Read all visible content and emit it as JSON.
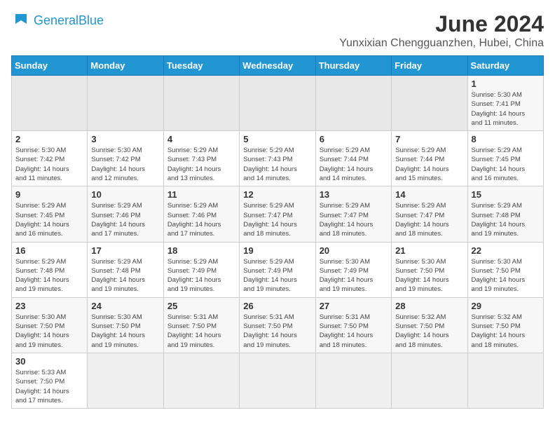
{
  "logo": {
    "text_general": "General",
    "text_blue": "Blue"
  },
  "title": "June 2024",
  "subtitle": "Yunxixian Chengguanzhen, Hubei, China",
  "weekdays": [
    "Sunday",
    "Monday",
    "Tuesday",
    "Wednesday",
    "Thursday",
    "Friday",
    "Saturday"
  ],
  "weeks": [
    [
      {
        "day": "",
        "info": ""
      },
      {
        "day": "",
        "info": ""
      },
      {
        "day": "",
        "info": ""
      },
      {
        "day": "",
        "info": ""
      },
      {
        "day": "",
        "info": ""
      },
      {
        "day": "",
        "info": ""
      },
      {
        "day": "1",
        "info": "Sunrise: 5:30 AM\nSunset: 7:41 PM\nDaylight: 14 hours\nand 11 minutes."
      }
    ],
    [
      {
        "day": "2",
        "info": "Sunrise: 5:30 AM\nSunset: 7:42 PM\nDaylight: 14 hours\nand 11 minutes."
      },
      {
        "day": "3",
        "info": "Sunrise: 5:30 AM\nSunset: 7:42 PM\nDaylight: 14 hours\nand 12 minutes."
      },
      {
        "day": "4",
        "info": "Sunrise: 5:29 AM\nSunset: 7:43 PM\nDaylight: 14 hours\nand 13 minutes."
      },
      {
        "day": "5",
        "info": "Sunrise: 5:29 AM\nSunset: 7:43 PM\nDaylight: 14 hours\nand 14 minutes."
      },
      {
        "day": "6",
        "info": "Sunrise: 5:29 AM\nSunset: 7:44 PM\nDaylight: 14 hours\nand 14 minutes."
      },
      {
        "day": "7",
        "info": "Sunrise: 5:29 AM\nSunset: 7:44 PM\nDaylight: 14 hours\nand 15 minutes."
      },
      {
        "day": "8",
        "info": "Sunrise: 5:29 AM\nSunset: 7:45 PM\nDaylight: 14 hours\nand 16 minutes."
      }
    ],
    [
      {
        "day": "9",
        "info": "Sunrise: 5:29 AM\nSunset: 7:45 PM\nDaylight: 14 hours\nand 16 minutes."
      },
      {
        "day": "10",
        "info": "Sunrise: 5:29 AM\nSunset: 7:46 PM\nDaylight: 14 hours\nand 17 minutes."
      },
      {
        "day": "11",
        "info": "Sunrise: 5:29 AM\nSunset: 7:46 PM\nDaylight: 14 hours\nand 17 minutes."
      },
      {
        "day": "12",
        "info": "Sunrise: 5:29 AM\nSunset: 7:47 PM\nDaylight: 14 hours\nand 18 minutes."
      },
      {
        "day": "13",
        "info": "Sunrise: 5:29 AM\nSunset: 7:47 PM\nDaylight: 14 hours\nand 18 minutes."
      },
      {
        "day": "14",
        "info": "Sunrise: 5:29 AM\nSunset: 7:47 PM\nDaylight: 14 hours\nand 18 minutes."
      },
      {
        "day": "15",
        "info": "Sunrise: 5:29 AM\nSunset: 7:48 PM\nDaylight: 14 hours\nand 19 minutes."
      }
    ],
    [
      {
        "day": "16",
        "info": "Sunrise: 5:29 AM\nSunset: 7:48 PM\nDaylight: 14 hours\nand 19 minutes."
      },
      {
        "day": "17",
        "info": "Sunrise: 5:29 AM\nSunset: 7:48 PM\nDaylight: 14 hours\nand 19 minutes."
      },
      {
        "day": "18",
        "info": "Sunrise: 5:29 AM\nSunset: 7:49 PM\nDaylight: 14 hours\nand 19 minutes."
      },
      {
        "day": "19",
        "info": "Sunrise: 5:29 AM\nSunset: 7:49 PM\nDaylight: 14 hours\nand 19 minutes."
      },
      {
        "day": "20",
        "info": "Sunrise: 5:30 AM\nSunset: 7:49 PM\nDaylight: 14 hours\nand 19 minutes."
      },
      {
        "day": "21",
        "info": "Sunrise: 5:30 AM\nSunset: 7:50 PM\nDaylight: 14 hours\nand 19 minutes."
      },
      {
        "day": "22",
        "info": "Sunrise: 5:30 AM\nSunset: 7:50 PM\nDaylight: 14 hours\nand 19 minutes."
      }
    ],
    [
      {
        "day": "23",
        "info": "Sunrise: 5:30 AM\nSunset: 7:50 PM\nDaylight: 14 hours\nand 19 minutes."
      },
      {
        "day": "24",
        "info": "Sunrise: 5:30 AM\nSunset: 7:50 PM\nDaylight: 14 hours\nand 19 minutes."
      },
      {
        "day": "25",
        "info": "Sunrise: 5:31 AM\nSunset: 7:50 PM\nDaylight: 14 hours\nand 19 minutes."
      },
      {
        "day": "26",
        "info": "Sunrise: 5:31 AM\nSunset: 7:50 PM\nDaylight: 14 hours\nand 19 minutes."
      },
      {
        "day": "27",
        "info": "Sunrise: 5:31 AM\nSunset: 7:50 PM\nDaylight: 14 hours\nand 18 minutes."
      },
      {
        "day": "28",
        "info": "Sunrise: 5:32 AM\nSunset: 7:50 PM\nDaylight: 14 hours\nand 18 minutes."
      },
      {
        "day": "29",
        "info": "Sunrise: 5:32 AM\nSunset: 7:50 PM\nDaylight: 14 hours\nand 18 minutes."
      }
    ],
    [
      {
        "day": "30",
        "info": "Sunrise: 5:33 AM\nSunset: 7:50 PM\nDaylight: 14 hours\nand 17 minutes."
      },
      {
        "day": "",
        "info": ""
      },
      {
        "day": "",
        "info": ""
      },
      {
        "day": "",
        "info": ""
      },
      {
        "day": "",
        "info": ""
      },
      {
        "day": "",
        "info": ""
      },
      {
        "day": "",
        "info": ""
      }
    ]
  ]
}
